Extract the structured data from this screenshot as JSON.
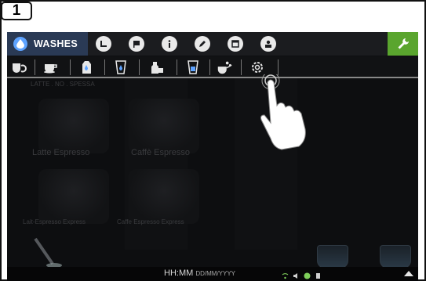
{
  "step": {
    "number": "1"
  },
  "navbar": {
    "active_tab_label": "WASHES",
    "icons": [
      "clock-icon",
      "flag-icon",
      "info-icon",
      "pencil-icon",
      "calendar-icon",
      "user-list-icon"
    ],
    "settings_icon": "wrench-icon",
    "accent_color": "#5aa52e",
    "active_tab_color": "#2a3a55"
  },
  "toolbar": {
    "icons": [
      "cup-refresh-icon",
      "cup-icon",
      "milk-carton-icon",
      "glass-water-icon",
      "bottle-hand-icon",
      "glass-icon",
      "cup-bubbles-icon",
      "gear-icon"
    ]
  },
  "background_ghost": {
    "text1": "Latte Espresso",
    "text2": "Caffè Espresso",
    "text3": "Lait-Espresso Express",
    "text4": "Caffe Espresso Express",
    "top_text": "LATTE . NO . SPESSA"
  },
  "statusbar": {
    "time": "HH:MM",
    "date": "DD/MM/YYYY"
  }
}
